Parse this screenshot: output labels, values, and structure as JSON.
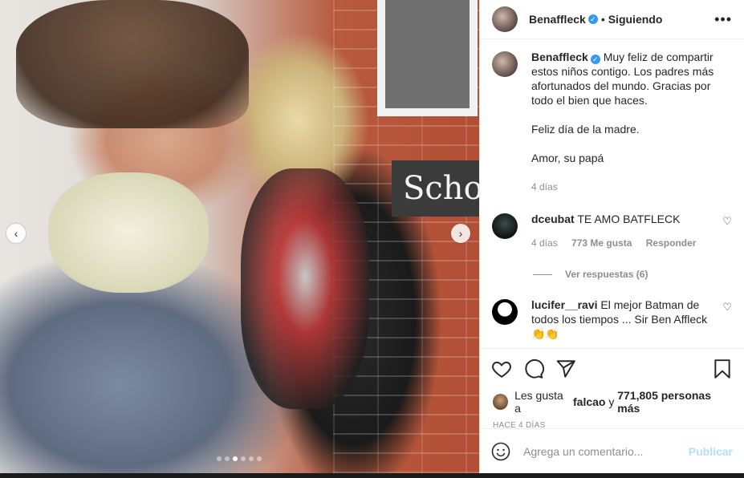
{
  "photo": {
    "sign_text": "Schoo",
    "carousel": {
      "total": 6,
      "active_index": 3
    }
  },
  "post": {
    "author": "Benaffleck",
    "follow_status": "Siguiendo",
    "separator": "•",
    "caption_lines": [
      "Muy feliz de compartir estos niños contigo. Los padres más afortunados del mundo. Gracias por todo el bien que haces.",
      "Feliz día de la madre.",
      "Amor, su papá"
    ],
    "caption_time": "4 días"
  },
  "comments": [
    {
      "user": "dceubat",
      "text": "TE AMO BATFLECK",
      "time": "4 días",
      "likes": "773 Me gusta",
      "reply_label": "Responder",
      "view_replies": "Ver respuestas (6)"
    },
    {
      "user": "lucifer__ravi",
      "text": "El mejor Batman de todos los tiempos ... Sir Ben Affleck 👏👏"
    }
  ],
  "likes_line": {
    "prefix": "Les gusta a",
    "user": "falcao",
    "joiner": "y",
    "count_text": "771,805 personas más"
  },
  "time_ago": "HACE 4 DÍAS",
  "comment_box": {
    "placeholder": "Agrega un comentario...",
    "publish_label": "Publicar"
  },
  "icons": {
    "more": "more-horizontal-icon",
    "verified": "verified-badge-icon",
    "like": "heart-icon",
    "comment": "comment-icon",
    "share": "send-icon",
    "save": "bookmark-icon",
    "emoji": "emoji-icon",
    "prev": "chevron-left-icon",
    "next": "chevron-right-icon"
  },
  "colors": {
    "verified": "#3897f0",
    "publish_disabled": "#b2dffc",
    "muted": "#8e8e8e",
    "text": "#262626"
  }
}
